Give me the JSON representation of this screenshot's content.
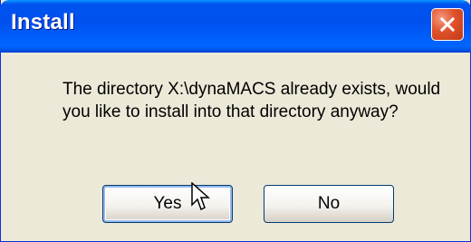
{
  "dialog": {
    "title": "Install",
    "message": "The directory X:\\dynaMACS already exists, would you like to install into that directory anyway?",
    "buttons": {
      "yes_label": "Yes",
      "no_label": "No"
    }
  },
  "icons": {
    "close": "close-icon",
    "cursor": "mouse-pointer-icon"
  },
  "colors": {
    "titlebar": "#0054e3",
    "close_button": "#e0512b",
    "dialog_background": "#ece9d8",
    "default_button_focus": "#98b8ea"
  }
}
